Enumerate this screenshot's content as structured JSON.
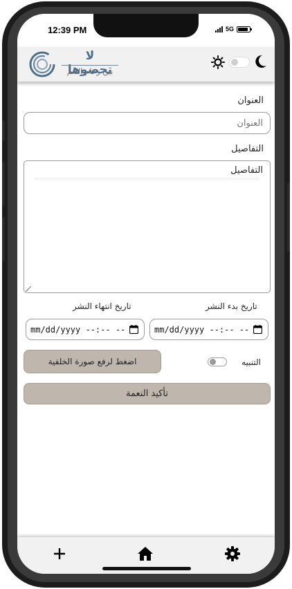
{
  "status_bar": {
    "time": "12:39 PM",
    "network": "5G",
    "battery_level": 0.9
  },
  "header": {
    "logo_title": "لا تحصوها",
    "logo_subtitle": "بين زحام النعم",
    "logo_icon": "ring-logo",
    "theme_toggle_on": false,
    "icons": {
      "light": "sun-icon",
      "dark": "moon-icon"
    }
  },
  "form": {
    "title_label": "العنوان",
    "title_placeholder": "العنوان",
    "details_label": "التفاصيل",
    "details_placeholder": "التفاصيل",
    "start_date_label": "تاريخ بدء النشر",
    "start_date_placeholder": "mm/dd/yyyy --:-- --",
    "end_date_label": "تاريخ انتهاء النشر",
    "end_date_placeholder": "mm/dd/yyyy --:-- --",
    "upload_button": "اضغط لرفع صورة الخلفية",
    "alert_label": "التنبيه",
    "alert_on": false,
    "confirm_button": "تأكيد النعمة"
  },
  "bottom_nav": {
    "items": [
      {
        "name": "add",
        "icon": "plus-icon"
      },
      {
        "name": "home",
        "icon": "home-icon"
      },
      {
        "name": "settings",
        "icon": "gear-icon"
      }
    ]
  },
  "colors": {
    "header_bg": "#f1f1f1",
    "button_bg": "#bfb7ad",
    "logo_blue": "#4d6e8a",
    "frame": "#1c1c1c"
  }
}
